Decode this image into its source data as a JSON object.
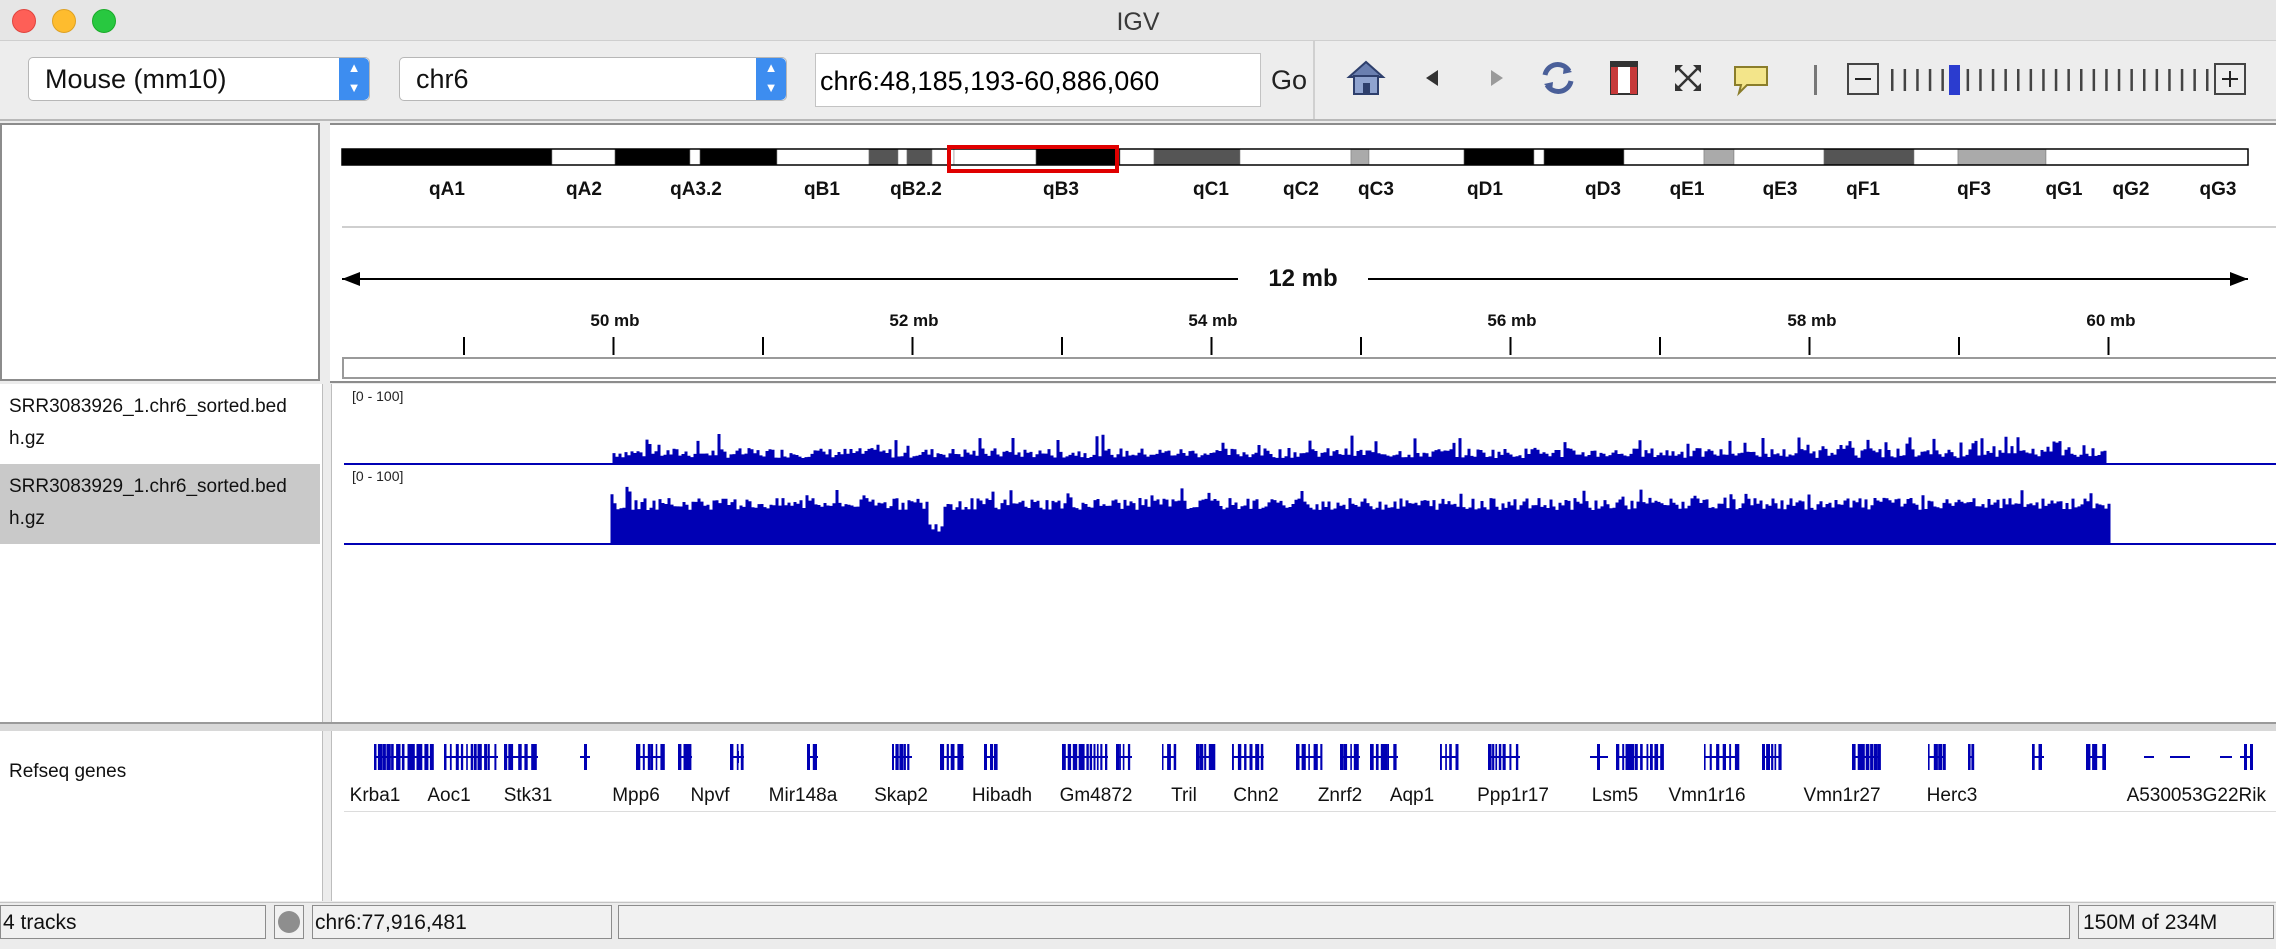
{
  "window": {
    "title": "IGV"
  },
  "toolbar": {
    "genome": "Mouse (mm10)",
    "chromosome": "chr6",
    "locus": "chr6:48,185,193-60,886,060",
    "go_label": "Go"
  },
  "ideogram": {
    "bands": [
      "qA1",
      "qA2",
      "qA3.2",
      "qB1",
      "qB2.2",
      "qB3",
      "qC1",
      "qC2",
      "qC3",
      "qD1",
      "qD3",
      "qE1",
      "qE3",
      "qF1",
      "qF3",
      "qG1",
      "qG2",
      "qG3"
    ]
  },
  "ruler": {
    "span_label": "12 mb",
    "tick_labels": [
      "50 mb",
      "52 mb",
      "54 mb",
      "56 mb",
      "58 mb",
      "60 mb"
    ]
  },
  "tracks": [
    {
      "name_line1": "SRR3083926_1.chr6_sorted.bed",
      "name_line2": "h.gz",
      "range": "[0 - 100]"
    },
    {
      "name_line1": "SRR3083929_1.chr6_sorted.bed",
      "name_line2": "h.gz",
      "range": "[0 - 100]"
    }
  ],
  "genes_track": {
    "name": "Refseq genes",
    "gene_labels": [
      "Krba1",
      "Aoc1",
      "Stk31",
      "Mpp6",
      "Npvf",
      "Mir148a",
      "Skap2",
      "Hibadh",
      "Gm4872",
      "Tril",
      "Chn2",
      "Znrf2",
      "Aqp1",
      "Ppp1r17",
      "Lsm5",
      "Vmn1r16",
      "Vmn1r27",
      "Herc3",
      "A530053G22Rik"
    ]
  },
  "status": {
    "tracks": "4 tracks",
    "position": "chr6:77,916,481",
    "memory": "150M of 234M"
  },
  "colors": {
    "coverage": "#0000b4",
    "locus_box": "#e00000",
    "combo_accent": "#3d8df0"
  }
}
